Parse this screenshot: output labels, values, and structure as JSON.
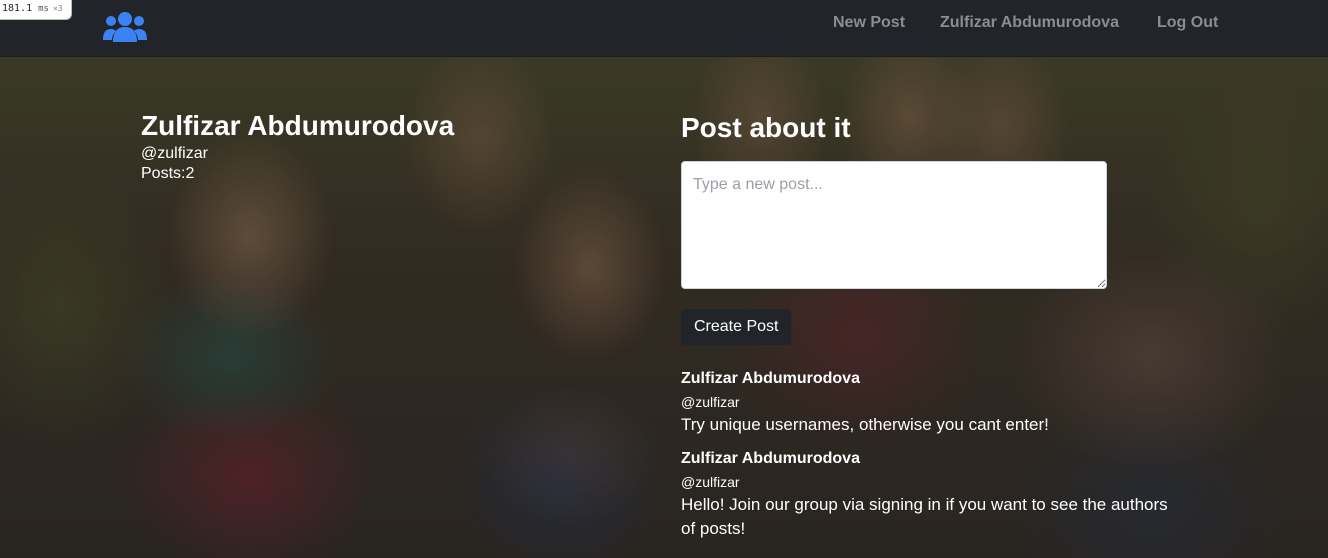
{
  "perf": {
    "value": "181.1",
    "unit": "ms",
    "multiplier": "×3"
  },
  "navbar": {
    "brand_icon": "users-icon",
    "links": [
      {
        "label": "New Post"
      },
      {
        "label": "Zulfizar Abdumurodova"
      },
      {
        "label": "Log Out"
      }
    ]
  },
  "profile": {
    "name": "Zulfizar Abdumurodova",
    "handle": "@zulfizar",
    "posts_count": "Posts:2"
  },
  "composer": {
    "heading": "Post about it",
    "placeholder": "Type a new post...",
    "value": "",
    "submit_label": "Create Post"
  },
  "posts": [
    {
      "author": "Zulfizar Abdumurodova",
      "handle": "@zulfizar",
      "body": "Try unique usernames, otherwise you cant enter!"
    },
    {
      "author": "Zulfizar Abdumurodova",
      "handle": "@zulfizar",
      "body": "Hello! Join our group via signing in if you want to see the authors of posts!"
    }
  ],
  "colors": {
    "navbar": "#212529",
    "brand_icon": "#3b82f6",
    "nav_link": "#8a8e93",
    "button": "#212529"
  }
}
